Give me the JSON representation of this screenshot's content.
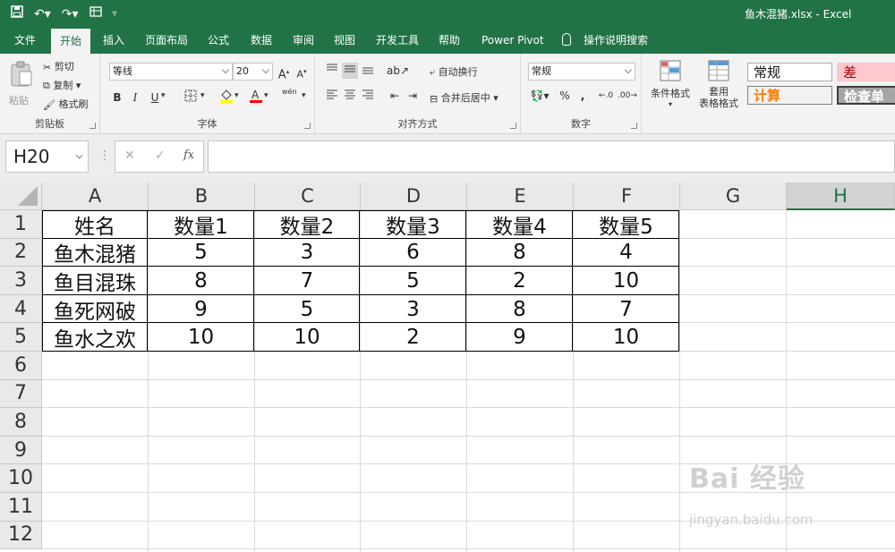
{
  "window": {
    "title": "鱼木混猪.xlsx  -  Excel"
  },
  "ribbon_tabs": [
    "文件",
    "开始",
    "插入",
    "页面布局",
    "公式",
    "数据",
    "审阅",
    "视图",
    "开发工具",
    "帮助",
    "Power Pivot",
    "操作说明搜索"
  ],
  "active_tab": "开始",
  "clipboard": {
    "paste": "粘贴",
    "cut": "剪切",
    "copy": "复制",
    "format_painter": "格式刷",
    "label": "剪贴板"
  },
  "font": {
    "name": "等线",
    "size": "20",
    "label": "字体",
    "bold": "B",
    "italic": "I",
    "underline": "U",
    "grow": "A",
    "shrink": "A",
    "wen": "wén"
  },
  "alignment": {
    "wrap": "自动换行",
    "merge": "合并后居中",
    "label": "对齐方式"
  },
  "number": {
    "format": "常规",
    "percent": "%",
    "comma": ",",
    "label": "数字"
  },
  "styles": {
    "conditional": "条件格式",
    "table_format_l1": "套用",
    "table_format_l2": "表格格式",
    "normal": "常规",
    "bad": "差",
    "calc": "计算",
    "check": "检查单"
  },
  "formula_bar": {
    "name_box": "H20",
    "fx": "fx",
    "cancel": "✕",
    "enter": "✓"
  },
  "columns": [
    "A",
    "B",
    "C",
    "D",
    "E",
    "F",
    "G",
    "H"
  ],
  "selected_column": "H",
  "rows": [
    "1",
    "2",
    "3",
    "4",
    "5",
    "6",
    "7",
    "8",
    "9",
    "10",
    "11",
    "12"
  ],
  "table": {
    "header": [
      "姓名",
      "数量1",
      "数量2",
      "数量3",
      "数量4",
      "数量5"
    ],
    "data": [
      [
        "鱼木混猪",
        "5",
        "3",
        "6",
        "8",
        "4"
      ],
      [
        "鱼目混珠",
        "8",
        "7",
        "5",
        "2",
        "10"
      ],
      [
        "鱼死网破",
        "9",
        "5",
        "3",
        "8",
        "7"
      ],
      [
        "鱼水之欢",
        "10",
        "10",
        "2",
        "9",
        "10"
      ]
    ]
  },
  "watermark": {
    "main": "Bai 经验",
    "sub": "jingyan.baidu.com"
  }
}
